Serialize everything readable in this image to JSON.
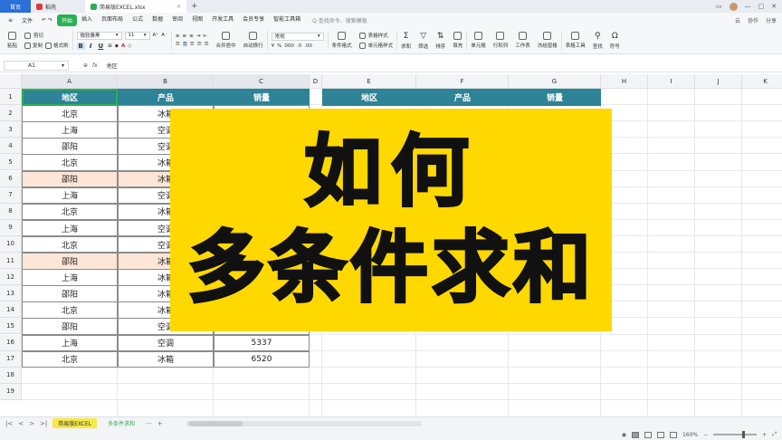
{
  "titlebar": {
    "home_tab": "首页",
    "doc_tab": "稻壳",
    "file_tab": "简易版EXCEL.xlsx",
    "close_glyph": "×",
    "new_tab_glyph": "+",
    "brand_color": "#2b6fd9"
  },
  "menubar": {
    "file": "文件",
    "items": [
      "开始",
      "插入",
      "页面布局",
      "公式",
      "数据",
      "审阅",
      "视图",
      "开发工具",
      "会员专享",
      "智能工具箱"
    ],
    "active_index": 0,
    "search": "Q 查找命令、搜索模板",
    "right": [
      "云",
      "协作",
      "分享"
    ],
    "accent_color": "#2ab053"
  },
  "ribbon": {
    "paste": "粘贴",
    "cut": "剪切",
    "copy": "复制",
    "format_painter": "格式刷",
    "font_name": "微软雅黑",
    "font_size": "11",
    "bold": "B",
    "italic": "I",
    "underline": "U",
    "merge": "合并居中",
    "wrap": "自动换行",
    "number_format": "常规",
    "cond_format": "条件格式",
    "table_style": "表格样式",
    "cell_style": "单元格样式",
    "sum": "求和",
    "filter": "筛选",
    "sort": "排序",
    "fill": "填充",
    "cell": "单元格",
    "rowcol": "行和列",
    "worksheet": "工作表",
    "freeze": "冻结窗格",
    "table_tools": "表格工具",
    "find": "查找",
    "symbol": "符号"
  },
  "formulabar": {
    "cell_ref": "A1",
    "fx_icons": [
      "⊕",
      "fx"
    ],
    "value": "地区"
  },
  "grid": {
    "columns": [
      "A",
      "B",
      "C",
      "D",
      "E",
      "F",
      "G",
      "H",
      "I",
      "J",
      "K"
    ],
    "rows": [
      "1",
      "2",
      "3",
      "4",
      "5",
      "6",
      "7",
      "8",
      "9",
      "10",
      "11",
      "12",
      "13",
      "14",
      "15",
      "16",
      "17",
      "18",
      "19"
    ],
    "table_left": {
      "headers": [
        "地区",
        "产品",
        "销量"
      ],
      "data": [
        [
          "北京",
          "冰箱",
          ""
        ],
        [
          "上海",
          "空调",
          ""
        ],
        [
          "邵阳",
          "空调",
          ""
        ],
        [
          "北京",
          "冰箱",
          ""
        ],
        [
          "邵阳",
          "冰箱",
          ""
        ],
        [
          "上海",
          "空调",
          ""
        ],
        [
          "北京",
          "冰箱",
          ""
        ],
        [
          "上海",
          "空调",
          ""
        ],
        [
          "北京",
          "空调",
          ""
        ],
        [
          "邵阳",
          "冰箱",
          ""
        ],
        [
          "上海",
          "冰箱",
          ""
        ],
        [
          "邵阳",
          "冰箱",
          ""
        ],
        [
          "北京",
          "冰箱",
          ""
        ],
        [
          "邵阳",
          "空调",
          "15036"
        ],
        [
          "上海",
          "空调",
          "5337"
        ],
        [
          "北京",
          "冰箱",
          "6520"
        ]
      ],
      "highlight_rows": [
        4,
        9
      ]
    },
    "table_right": {
      "headers": [
        "地区",
        "产品",
        "销量"
      ]
    },
    "header_color": "#2e8396",
    "highlight_color": "#fde6d8"
  },
  "banner": {
    "line1": "如何",
    "line2": "多条件求和",
    "bg_color": "#ffd800"
  },
  "sheettabs": {
    "nav": [
      "|<",
      "<",
      ">",
      ">|"
    ],
    "tabs": [
      "简易版EXCEL",
      "多条件求和"
    ],
    "more": "···",
    "add": "+"
  },
  "statusbar": {
    "zoom": "160%",
    "zoom_out": "−",
    "zoom_in": "+"
  }
}
